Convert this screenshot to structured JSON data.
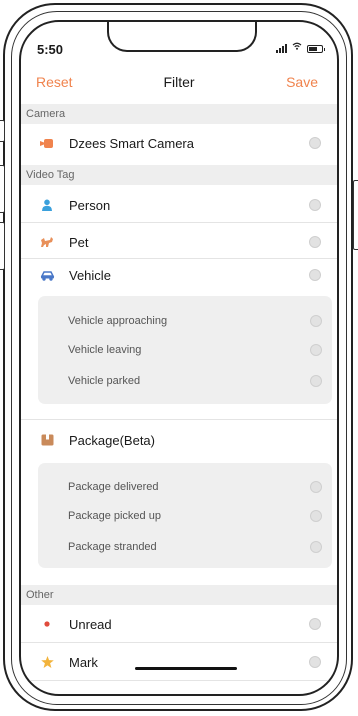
{
  "status": {
    "time": "5:50"
  },
  "nav": {
    "reset": "Reset",
    "title": "Filter",
    "save": "Save"
  },
  "sections": {
    "camera": {
      "header": "Camera",
      "item": "Dzees Smart Camera"
    },
    "video_tag": {
      "header": "Video Tag",
      "person": "Person",
      "pet": "Pet",
      "vehicle": "Vehicle",
      "vehicle_sub": [
        "Vehicle approaching",
        "Vehicle leaving",
        "Vehicle parked"
      ],
      "package": "Package(Beta)",
      "package_sub": [
        "Package delivered",
        "Package picked up",
        "Package stranded"
      ]
    },
    "other": {
      "header": "Other",
      "unread": "Unread",
      "mark": "Mark"
    }
  },
  "colors": {
    "accent": "#f0834d",
    "person": "#3aa0dc",
    "vehicle": "#4a78c8",
    "unread": "#e04b3c",
    "mark": "#f2b33c",
    "package": "#c98a5a"
  },
  "icons": {
    "camera": "camera-icon",
    "person": "person-icon",
    "pet": "pet-icon",
    "vehicle": "car-icon",
    "package": "package-icon",
    "unread": "dot-icon",
    "mark": "star-icon"
  }
}
